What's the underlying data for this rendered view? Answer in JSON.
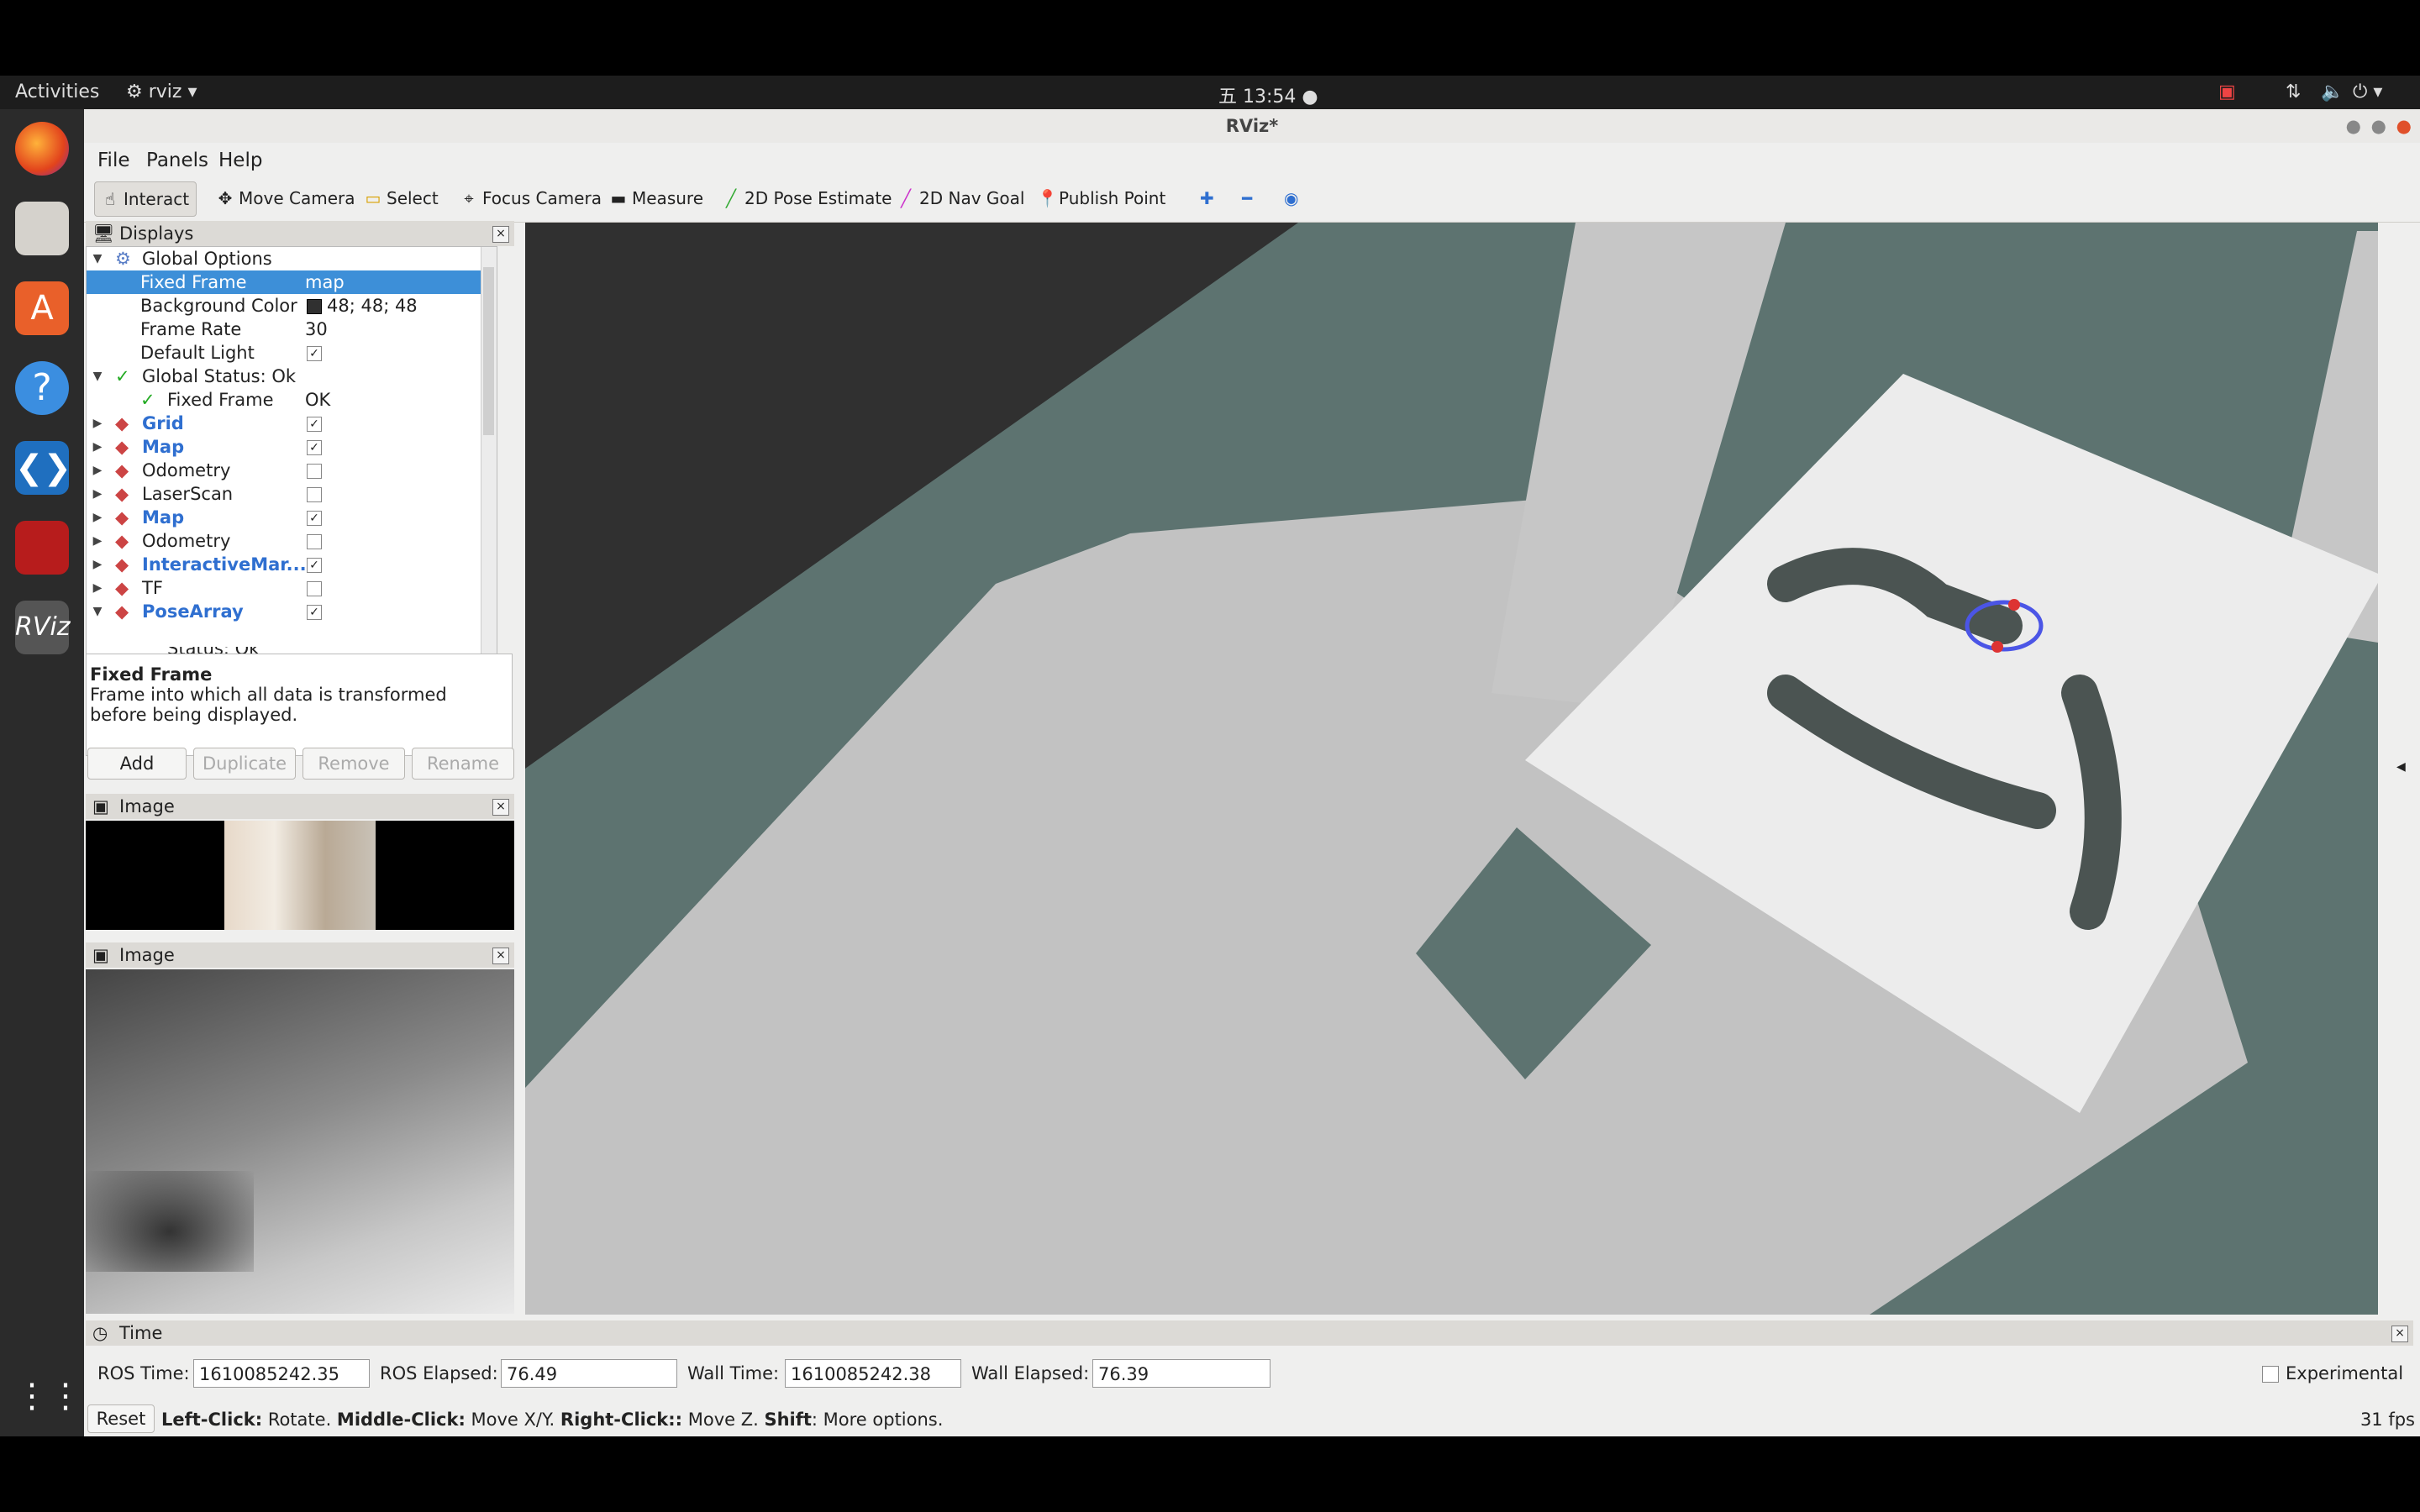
{
  "topbar": {
    "activities": "Activities",
    "app_menu": "rviz",
    "clock": "五 13:54"
  },
  "window": {
    "title": "RViz*"
  },
  "menu": {
    "file": "File",
    "panels": "Panels",
    "help": "Help"
  },
  "toolbar": {
    "interact": "Interact",
    "move_camera": "Move Camera",
    "select": "Select",
    "focus_camera": "Focus Camera",
    "measure": "Measure",
    "pose_estimate": "2D Pose Estimate",
    "nav_goal": "2D Nav Goal",
    "publish_point": "Publish Point"
  },
  "displays": {
    "title": "Displays",
    "global_options": "Global Options",
    "fixed_frame": {
      "label": "Fixed Frame",
      "value": "map"
    },
    "background_color": {
      "label": "Background Color",
      "value": "48; 48; 48",
      "swatch": "#303030"
    },
    "frame_rate": {
      "label": "Frame Rate",
      "value": "30"
    },
    "default_light": {
      "label": "Default Light"
    },
    "global_status": "Global Status: Ok",
    "status_fixed_frame": {
      "label": "Fixed Frame",
      "value": "OK"
    },
    "items": [
      {
        "label": "Grid",
        "checked": true,
        "blue": true
      },
      {
        "label": "Map",
        "checked": true,
        "blue": true
      },
      {
        "label": "Odometry",
        "checked": false,
        "blue": false
      },
      {
        "label": "LaserScan",
        "checked": false,
        "blue": false
      },
      {
        "label": "Map",
        "checked": true,
        "blue": true
      },
      {
        "label": "Odometry",
        "checked": false,
        "blue": false
      },
      {
        "label": "InteractiveMar...",
        "checked": true,
        "blue": true
      },
      {
        "label": "TF",
        "checked": false,
        "blue": false
      },
      {
        "label": "PoseArray",
        "checked": true,
        "blue": true
      }
    ],
    "partial_row": "Status: Ok",
    "desc_title": "Fixed Frame",
    "desc_text": "Frame into which all data is transformed before being displayed.",
    "buttons": {
      "add": "Add",
      "duplicate": "Duplicate",
      "remove": "Remove",
      "rename": "Rename"
    }
  },
  "image_panel_1": {
    "title": "Image"
  },
  "image_panel_2": {
    "title": "Image"
  },
  "time": {
    "title": "Time",
    "ros_time_label": "ROS Time:",
    "ros_time": "1610085242.35",
    "ros_elapsed_label": "ROS Elapsed:",
    "ros_elapsed": "76.49",
    "wall_time_label": "Wall Time:",
    "wall_time": "1610085242.38",
    "wall_elapsed_label": "Wall Elapsed:",
    "wall_elapsed": "76.39",
    "experimental": "Experimental"
  },
  "status": {
    "reset": "Reset",
    "left_click": "Left-Click:",
    "left_action": " Rotate. ",
    "middle_click": "Middle-Click:",
    "middle_action": " Move X/Y. ",
    "right_click": "Right-Click::",
    "right_action": " Move Z. ",
    "shift": "Shift",
    "shift_action": ": More options.",
    "fps": "31 fps"
  }
}
